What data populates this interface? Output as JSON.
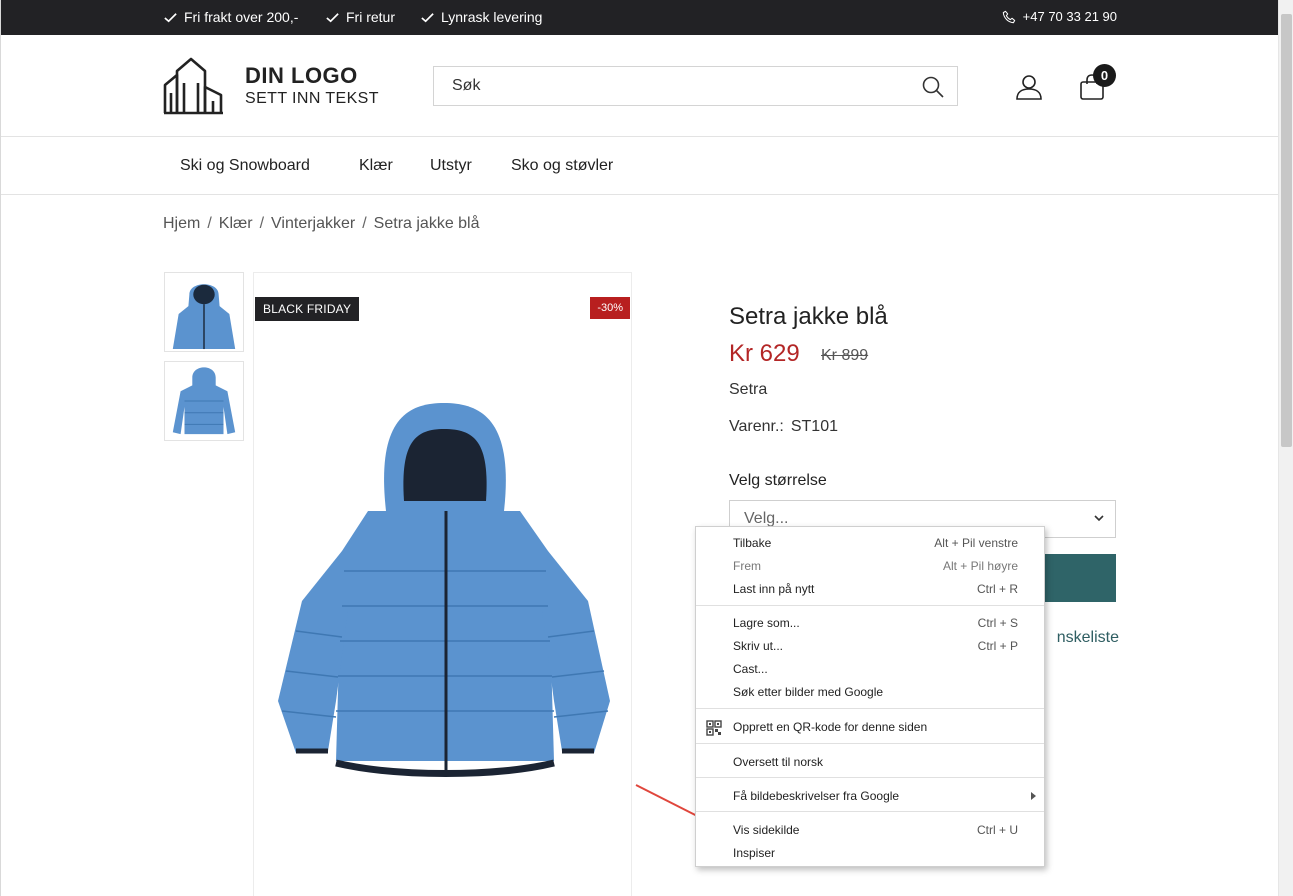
{
  "topbar": {
    "usps": [
      "Fri frakt over 200,-",
      "Fri retur",
      "Lynrask levering"
    ],
    "phone": "+47 70 33 21 90"
  },
  "header": {
    "logo_title": "DIN LOGO",
    "logo_subtitle": "SETT INN TEKST",
    "search_placeholder": "Søk",
    "cart_count": "0"
  },
  "nav": {
    "items": [
      "Ski og Snowboard",
      "Klær",
      "Utstyr",
      "Sko og støvler"
    ]
  },
  "breadcrumb": [
    "Hjem",
    "Klær",
    "Vinterjakker",
    "Setra jakke blå"
  ],
  "breadcrumb_separator": "/",
  "product": {
    "badge": "BLACK FRIDAY",
    "discount": "-30%",
    "title": "Setra jakke blå",
    "price": "Kr 629",
    "old_price": "Kr 899",
    "brand": "Setra",
    "sku_label": "Varenr.:",
    "sku": "ST101",
    "size_label": "Velg størrelse",
    "size_value": "Velg...",
    "wishlist_visible_text": "nskeliste",
    "jacket_color": "#5b93cf",
    "buy_button_color": "#2f6468"
  },
  "context_menu": {
    "groups": [
      [
        {
          "label": "Tilbake",
          "shortcut": "Alt + Pil venstre",
          "disabled": false
        },
        {
          "label": "Frem",
          "shortcut": "Alt + Pil høyre",
          "disabled": true
        },
        {
          "label": "Last inn på nytt",
          "shortcut": "Ctrl + R",
          "disabled": false
        }
      ],
      [
        {
          "label": "Lagre som...",
          "shortcut": "Ctrl + S",
          "disabled": false
        },
        {
          "label": "Skriv ut...",
          "shortcut": "Ctrl + P",
          "disabled": false
        },
        {
          "label": "Cast...",
          "shortcut": "",
          "disabled": false
        },
        {
          "label": "Søk etter bilder med Google",
          "shortcut": "",
          "disabled": false
        }
      ],
      [
        {
          "label": "Opprett en QR-kode for denne siden",
          "shortcut": "",
          "icon": "qr-code-icon",
          "disabled": false
        }
      ],
      [
        {
          "label": "Oversett til norsk",
          "shortcut": "",
          "disabled": false
        }
      ],
      [
        {
          "label": "Få bildebeskrivelser fra Google",
          "shortcut": "",
          "submenu": true,
          "disabled": false
        }
      ],
      [
        {
          "label": "Vis sidekilde",
          "shortcut": "Ctrl + U",
          "disabled": false
        },
        {
          "label": "Inspiser",
          "shortcut": "",
          "disabled": false
        }
      ]
    ]
  },
  "annotation": {
    "arrow_color": "#e0463c"
  }
}
